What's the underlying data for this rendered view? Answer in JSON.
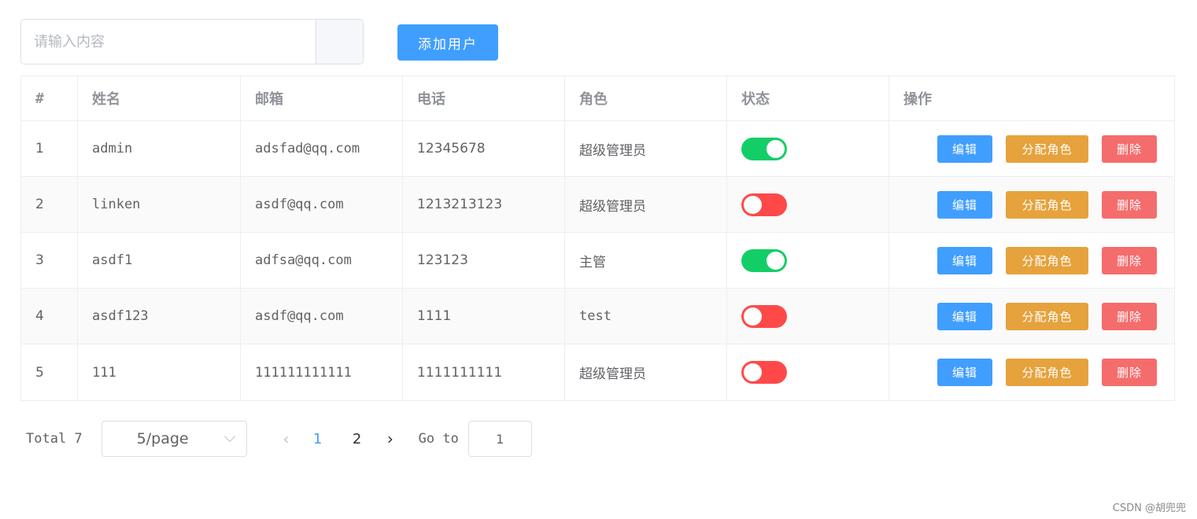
{
  "search": {
    "placeholder": "请输入内容",
    "value": ""
  },
  "toolbar": {
    "add_user_label": "添加用户"
  },
  "table": {
    "columns": [
      "#",
      "姓名",
      "邮箱",
      "电话",
      "角色",
      "状态",
      "操作"
    ],
    "rows": [
      {
        "index": "1",
        "name": "admin",
        "email": "adsfad@qq.com",
        "phone": "12345678",
        "role": "超级管理员",
        "status": true
      },
      {
        "index": "2",
        "name": "linken",
        "email": "asdf@qq.com",
        "phone": "1213213123",
        "role": "超级管理员",
        "status": false
      },
      {
        "index": "3",
        "name": "asdf1",
        "email": "adfsa@qq.com",
        "phone": "123123",
        "role": "主管",
        "status": true
      },
      {
        "index": "4",
        "name": "asdf123",
        "email": "asdf@qq.com",
        "phone": "1111",
        "role": "test",
        "status": false
      },
      {
        "index": "5",
        "name": "111",
        "email": "111111111111",
        "phone": "1111111111",
        "role": "超级管理员",
        "status": false
      }
    ],
    "actions": {
      "edit": "编辑",
      "assign_role": "分配角色",
      "delete": "删除"
    }
  },
  "pagination": {
    "total_label": "Total 7",
    "page_size": "5/page",
    "pages": [
      "1",
      "2"
    ],
    "current_page": "1",
    "goto_label": "Go to",
    "goto_value": "1"
  },
  "colors": {
    "primary": "#409eff",
    "warning": "#e6a23c",
    "danger": "#f56c6c",
    "switch_on": "#13ce66",
    "switch_off": "#ff4949"
  },
  "watermark": "CSDN @胡兜兜"
}
